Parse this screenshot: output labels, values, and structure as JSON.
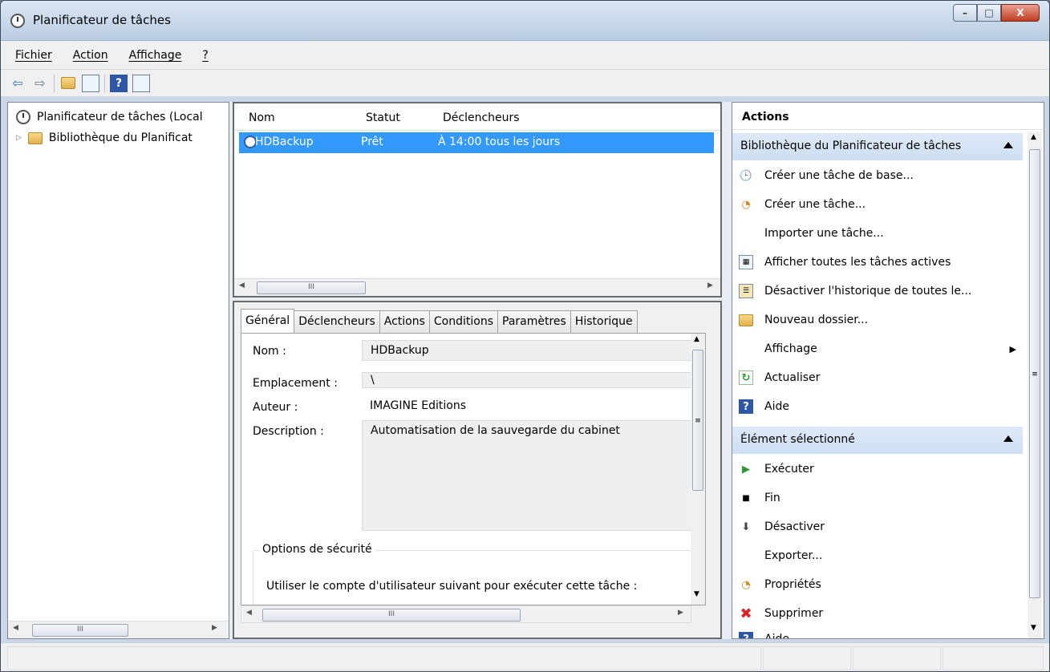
{
  "window": {
    "title": "Planificateur de tâches",
    "controls": {
      "minimize": "–",
      "maximize": "□",
      "close": "X"
    }
  },
  "menu": [
    "Fichier",
    "Action",
    "Affichage",
    "?"
  ],
  "toolbar": {
    "back": "⇦",
    "forward": "⇨",
    "help": "?"
  },
  "tree": {
    "root": "Planificateur de tâches (Local",
    "child": "Bibliothèque du Planificat",
    "scroll_thumb": "III"
  },
  "tasklist": {
    "columns": [
      "Nom",
      "Statut",
      "Déclencheurs"
    ],
    "rows": [
      {
        "name": "HDBackup",
        "status": "Prêt",
        "trigger": "À 14:00 tous les jours"
      }
    ],
    "scroll_thumb": "III"
  },
  "details": {
    "tabs": [
      "Général",
      "Déclencheurs",
      "Actions",
      "Conditions",
      "Paramètres",
      "Historique"
    ],
    "fields": {
      "name_label": "Nom :",
      "name_value": "HDBackup",
      "location_label": "Emplacement :",
      "location_value": "\\",
      "author_label": "Auteur :",
      "author_value": "IMAGINE Editions",
      "description_label": "Description :",
      "description_value": "Automatisation de la sauvegarde du cabinet"
    },
    "security_legend": "Options de sécurité",
    "security_text": "Utiliser le compte d'utilisateur suivant pour exécuter cette tâche :",
    "scroll_thumb": "III",
    "vscroll_grip": "≡"
  },
  "actions": {
    "title": "Actions",
    "section1": "Bibliothèque du Planificateur de tâches",
    "items1": [
      "Créer une tâche de base...",
      "Créer une tâche...",
      "Importer une tâche...",
      "Afficher toutes les tâches actives",
      "Désactiver l'historique de toutes le...",
      "Nouveau dossier...",
      "Affichage",
      "Actualiser",
      "Aide"
    ],
    "section2": "Élément sélectionné",
    "items2": [
      "Exécuter",
      "Fin",
      "Désactiver",
      "Exporter...",
      "Propriétés",
      "Supprimer",
      "Aide"
    ],
    "vscroll_grip": "≡"
  }
}
